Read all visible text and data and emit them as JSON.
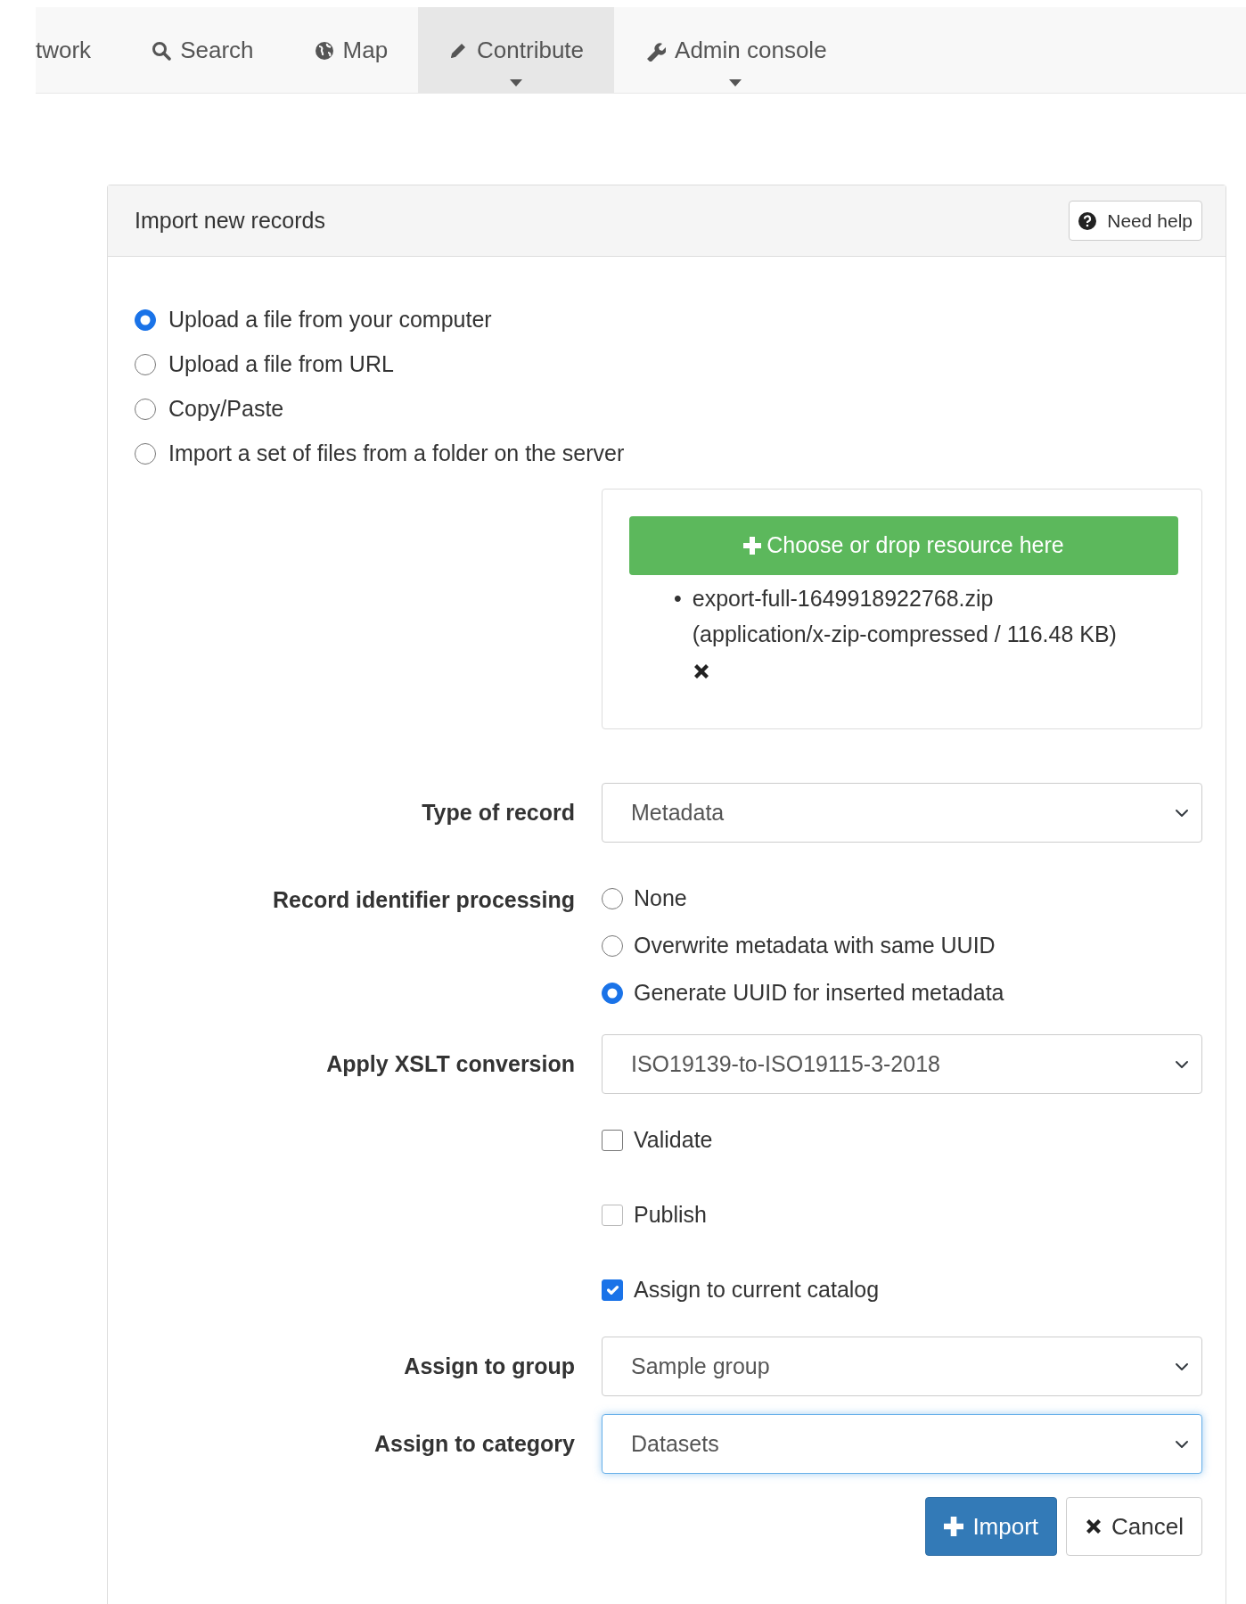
{
  "nav": {
    "items": [
      {
        "label": "twork",
        "selected": false,
        "dropdown": false
      },
      {
        "label": "Search",
        "selected": false,
        "dropdown": false
      },
      {
        "label": "Map",
        "selected": false,
        "dropdown": false
      },
      {
        "label": "Contribute",
        "selected": true,
        "dropdown": true
      },
      {
        "label": "Admin console",
        "selected": false,
        "dropdown": true
      }
    ]
  },
  "panel": {
    "title": "Import new records",
    "help_button": "Need help",
    "source_options": [
      {
        "label": "Upload a file from your computer",
        "selected": true
      },
      {
        "label": "Upload a file from URL",
        "selected": false
      },
      {
        "label": "Copy/Paste",
        "selected": false
      },
      {
        "label": "Import a set of files from a folder on the server",
        "selected": false
      }
    ],
    "upload": {
      "button": "Choose or drop resource here",
      "files": [
        {
          "bullet": "•",
          "name": "export-full-1649918922768.zip",
          "details": "(application/x-zip-compressed / 116.48 KB)"
        }
      ]
    },
    "fields": [
      {
        "kind": "select",
        "label": "Type of record",
        "value": "Metadata",
        "focused": false
      },
      {
        "kind": "radios",
        "label": "Record identifier processing",
        "options": [
          {
            "label": "None",
            "selected": false
          },
          {
            "label": "Overwrite metadata with same UUID",
            "selected": false
          },
          {
            "label": "Generate UUID for inserted metadata",
            "selected": true
          }
        ]
      },
      {
        "kind": "select",
        "label": "Apply XSLT conversion",
        "value": "ISO19139-to-ISO19115-3-2018",
        "focused": false
      },
      {
        "kind": "checkbox",
        "text": "Validate",
        "checked": false,
        "disabled": false
      },
      {
        "kind": "checkbox",
        "text": "Publish",
        "checked": false,
        "disabled": true
      },
      {
        "kind": "checkbox",
        "text": "Assign to current catalog",
        "checked": true,
        "disabled": false
      },
      {
        "kind": "select",
        "label": "Assign to group",
        "value": "Sample group",
        "focused": false
      },
      {
        "kind": "select",
        "label": "Assign to category",
        "value": "Datasets",
        "focused": true
      }
    ],
    "buttons": [
      {
        "label": "Import",
        "kind": "primary"
      },
      {
        "label": "Cancel",
        "kind": "default"
      }
    ]
  }
}
